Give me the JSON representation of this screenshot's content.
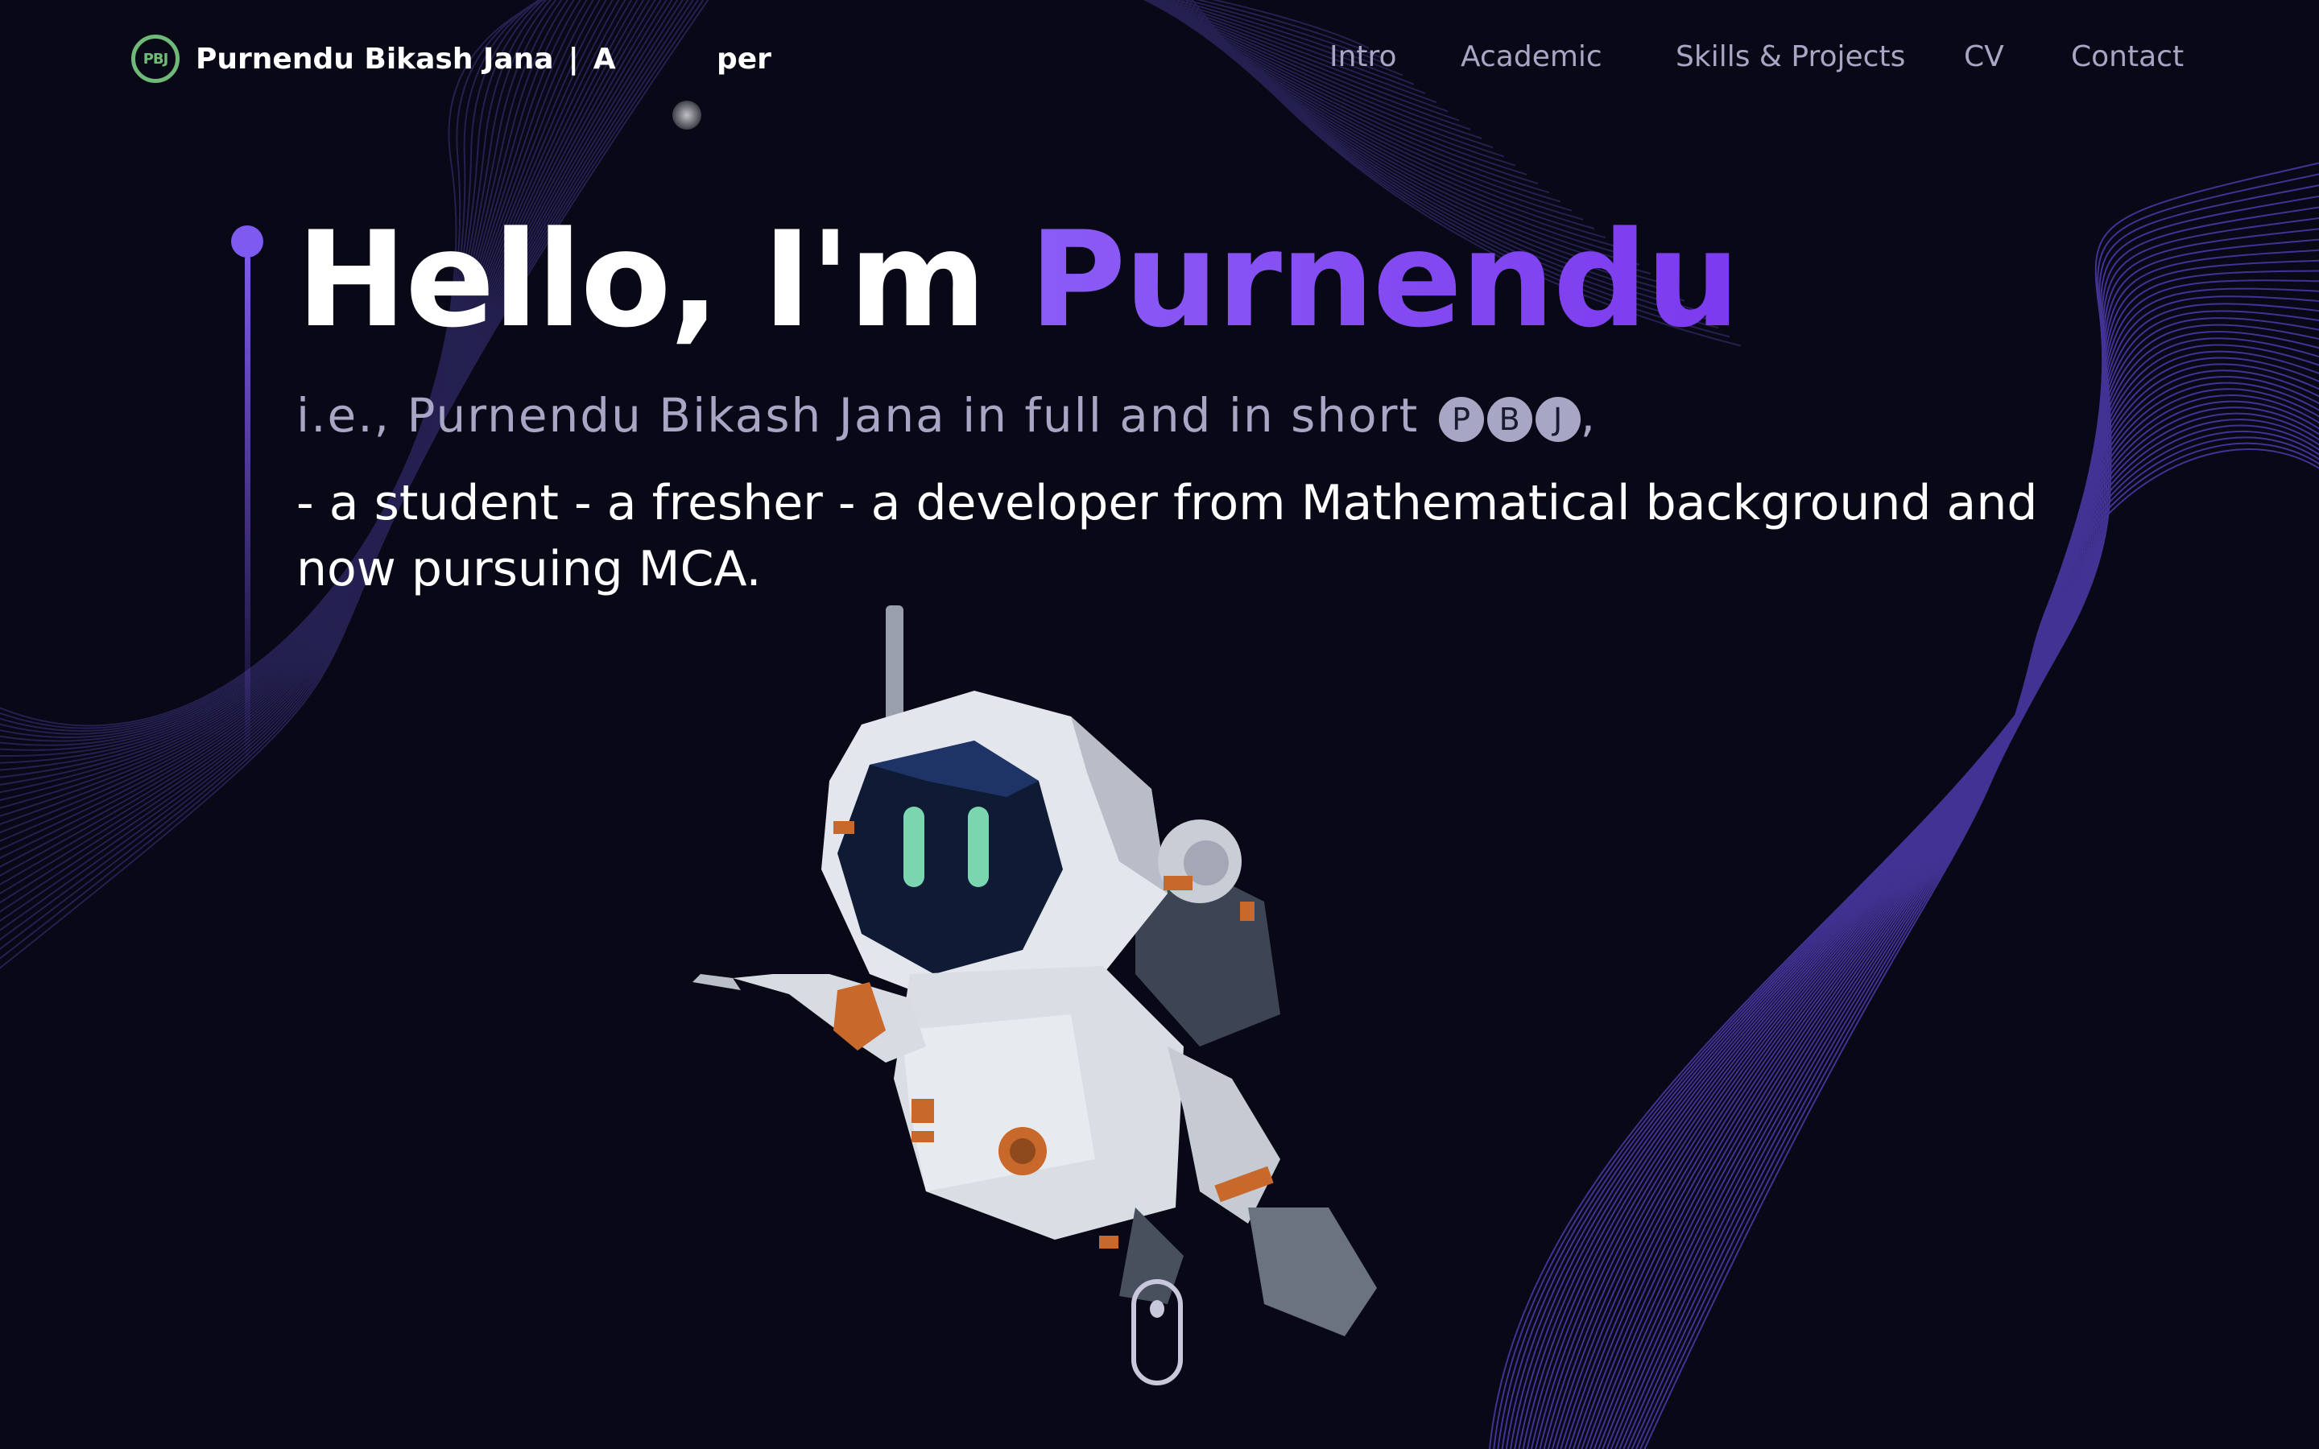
{
  "header": {
    "logo_text": "PBJ",
    "brand_name": "Purnendu Bikash Jana",
    "separator": "|",
    "role_text": "A          per"
  },
  "nav": {
    "items": [
      {
        "label": "Intro"
      },
      {
        "label": "Academic"
      },
      {
        "label": "Skills & Projects"
      },
      {
        "label": "CV"
      },
      {
        "label": "Contact"
      }
    ]
  },
  "hero": {
    "greeting": "Hello, I'm ",
    "name": "Purnendu",
    "subtitle": "i.e., Purnendu Bikash Jana in full and in short ",
    "badges": [
      "P",
      "B",
      "J"
    ],
    "subtitle_end": ",",
    "description": "- a student - a fresher - a developer from Mathematical background and now pursuing MCA."
  },
  "colors": {
    "background": "#080816",
    "accent_purple": "#7f5af0",
    "logo_green": "#6fb979",
    "muted_text": "#a7a6c4"
  },
  "icons": {
    "logo": "pbj-logo-icon",
    "illustration": "astronaut-illustration",
    "scroll": "mouse-scroll-icon"
  }
}
